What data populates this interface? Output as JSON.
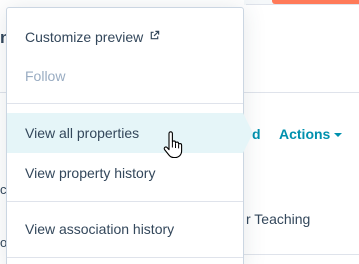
{
  "background": {
    "title_fragment": "n",
    "link_fragment": "d",
    "actions_label": "Actions",
    "teaching_fragment": "r Teaching",
    "left_text_1": "c",
    "left_text_2": "o"
  },
  "menu": {
    "items": [
      {
        "label": "Customize preview",
        "icon": "external-link-icon",
        "enabled": true
      },
      {
        "label": "Follow",
        "enabled": false
      },
      {
        "label": "View all properties",
        "enabled": true,
        "hovered": true
      },
      {
        "label": "View property history",
        "enabled": true
      },
      {
        "label": "View association history",
        "enabled": true
      }
    ]
  },
  "colors": {
    "accent_link": "#0091ae",
    "hover_bg": "#e5f5f8",
    "disabled_text": "#99acc2",
    "text": "#33475b",
    "brand_orange": "#ff7a59"
  }
}
